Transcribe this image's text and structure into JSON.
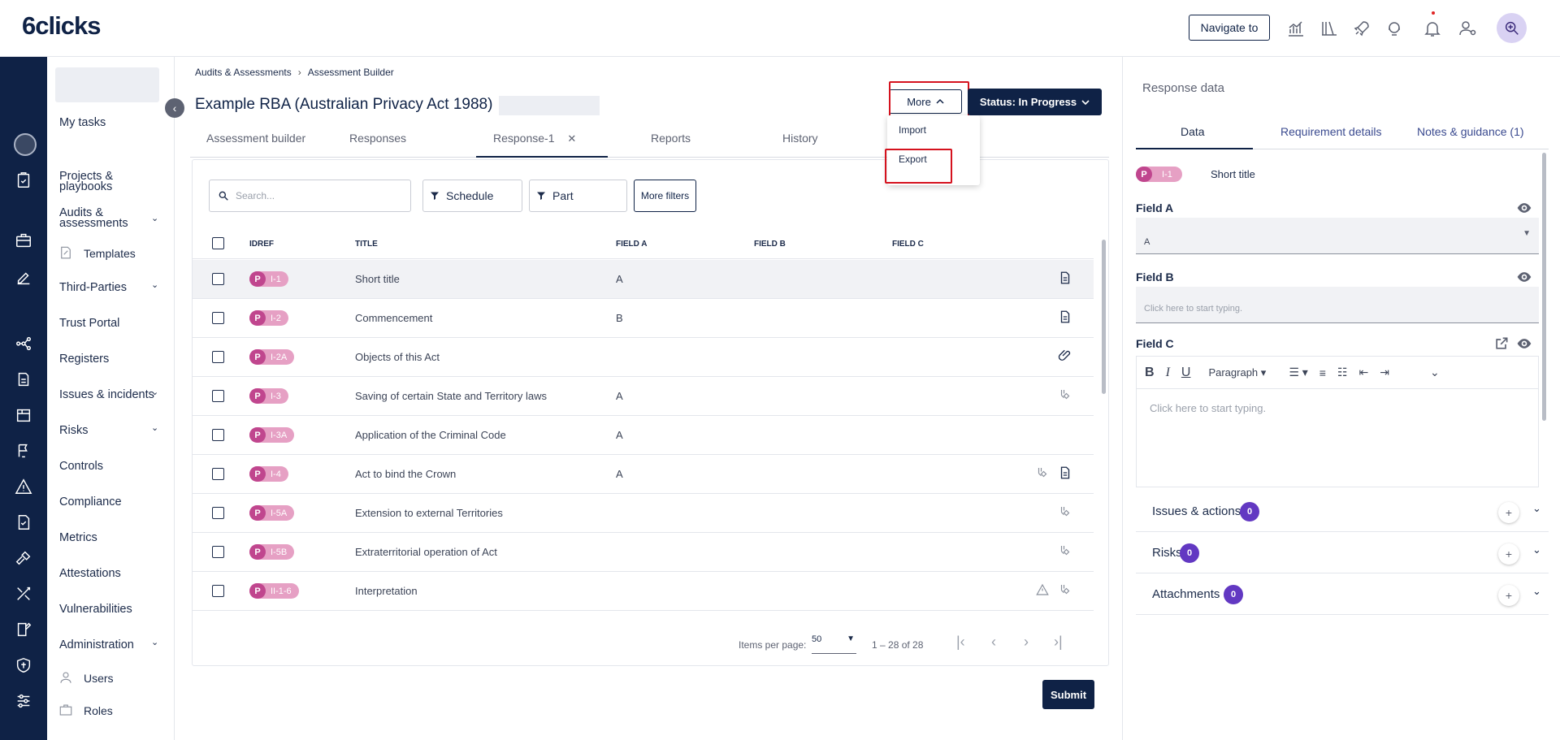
{
  "app": {
    "logo": "6clicks",
    "navigate_label": "Navigate to"
  },
  "sidebar": {
    "items": [
      {
        "label": "My tasks"
      },
      {
        "label": "Projects &"
      },
      {
        "label": "playbooks"
      },
      {
        "label": "Audits &"
      },
      {
        "label": "assessments"
      },
      {
        "label": "Templates"
      },
      {
        "label": "Third-Parties"
      },
      {
        "label": "Trust Portal"
      },
      {
        "label": "Registers"
      },
      {
        "label": "Issues & incidents"
      },
      {
        "label": "Risks"
      },
      {
        "label": "Controls"
      },
      {
        "label": "Compliance"
      },
      {
        "label": "Metrics"
      },
      {
        "label": "Attestations"
      },
      {
        "label": "Vulnerabilities"
      },
      {
        "label": "Administration"
      },
      {
        "label": "Users"
      },
      {
        "label": "Roles"
      }
    ],
    "collapse_glyph": "‹"
  },
  "breadcrumb": {
    "first": "Audits & Assessments",
    "sep": "›",
    "second": "Assessment Builder"
  },
  "page": {
    "title": "Example RBA (Australian Privacy Act 1988)",
    "more_label": "More",
    "status_label": "Status: In Progress",
    "dropdown": {
      "import": "Import",
      "export": "Export"
    }
  },
  "tabs": [
    {
      "label": "Assessment builder"
    },
    {
      "label": "Responses"
    },
    {
      "label": "Response-1"
    },
    {
      "label": "Reports"
    },
    {
      "label": "History"
    }
  ],
  "filters": {
    "search_placeholder": "Search...",
    "schedule": "Schedule",
    "part": "Part",
    "more_filters": "More filters"
  },
  "table": {
    "headers": {
      "idref": "IDREF",
      "title": "TITLE",
      "field_a": "FIELD A",
      "field_b": "FIELD B",
      "field_c": "FIELD C"
    },
    "rows": [
      {
        "p": "P",
        "id": "I-1",
        "title": "Short title",
        "a": "A",
        "icons": [
          "document-icon"
        ]
      },
      {
        "p": "P",
        "id": "I-2",
        "title": "Commencement",
        "a": "B",
        "icons": [
          "document-icon"
        ]
      },
      {
        "p": "P",
        "id": "I-2A",
        "title": "Objects of this Act",
        "a": "",
        "icons": [
          "paperclip-icon"
        ]
      },
      {
        "p": "P",
        "id": "I-3",
        "title": "Saving of certain State and Territory laws",
        "a": "A",
        "icons": [
          "link-control-icon"
        ]
      },
      {
        "p": "P",
        "id": "I-3A",
        "title": "Application of the Criminal Code",
        "a": "A",
        "icons": []
      },
      {
        "p": "P",
        "id": "I-4",
        "title": "Act to bind the Crown",
        "a": "A",
        "icons": [
          "link-control-icon",
          "document-icon"
        ]
      },
      {
        "p": "P",
        "id": "I-5A",
        "title": "Extension to external Territories",
        "a": "",
        "icons": [
          "link-control-icon"
        ]
      },
      {
        "p": "P",
        "id": "I-5B",
        "title": "Extraterritorial operation of Act",
        "a": "",
        "icons": [
          "link-control-icon"
        ]
      },
      {
        "p": "P",
        "id": "II-1-6",
        "title": "Interpretation",
        "a": "",
        "icons": [
          "warning-icon",
          "link-control-icon"
        ]
      }
    ]
  },
  "pager": {
    "items_label": "Items per page:",
    "per_page": "50",
    "range": "1 – 28 of 28",
    "first": "|‹",
    "prev": "‹",
    "next": "›",
    "last": "›|"
  },
  "submit_label": "Submit",
  "right_panel": {
    "title": "Response data",
    "tabs": [
      {
        "label": "Data"
      },
      {
        "label": "Requirement details"
      },
      {
        "label": "Notes & guidance (1)"
      }
    ],
    "chip_p": "P",
    "chip_id": "I-1",
    "short_title": "Short title",
    "field_a_label": "Field A",
    "field_a_value": "A",
    "field_b_label": "Field B",
    "field_b_placeholder": "Click here to start typing.",
    "field_c_label": "Field C",
    "toolbar": {
      "bold": "B",
      "italic": "I",
      "underline": "U",
      "paragraph": "Paragraph"
    },
    "editor_placeholder": "Click here to start typing.",
    "accordions": [
      {
        "label": "Issues & actions",
        "count": "0"
      },
      {
        "label": "Risks",
        "count": "0"
      },
      {
        "label": "Attachments",
        "count": "0"
      }
    ],
    "plus_glyph": "+",
    "chevron_glyph": "⌄"
  },
  "colors": {
    "navy": "#0f2246",
    "pink": "#c0468e",
    "pink_light": "#e6a0c4",
    "purple": "#6238c2",
    "highlight": "#d5121e"
  }
}
